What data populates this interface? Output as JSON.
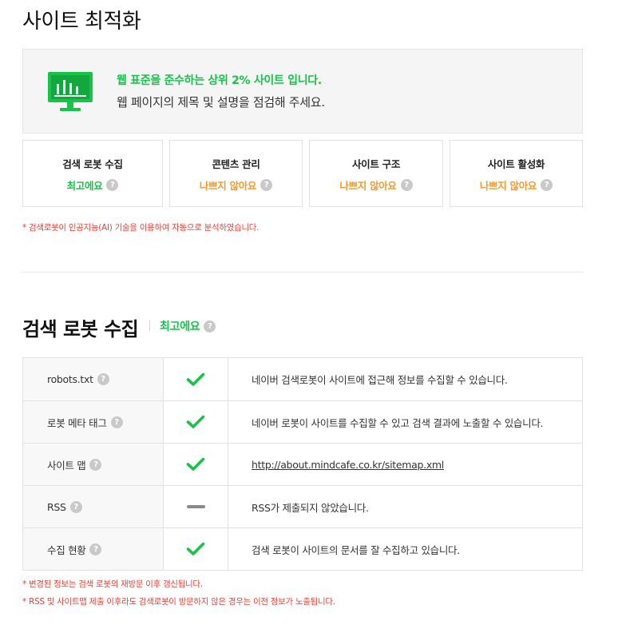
{
  "page_title": "사이트 최적화",
  "summary": {
    "headline": "웹 표준을 준수하는 상위 2% 사이트 입니다.",
    "description": "웹 페이지의 제목 및 설명을 점검해 주세요.",
    "icon": "monitor-chart-icon",
    "accent_color": "#19c24a"
  },
  "cards": [
    {
      "title": "검색 로봇 수집",
      "status": "최고에요",
      "status_color": "#19c24a"
    },
    {
      "title": "콘텐츠 관리",
      "status": "나쁘지 않아요",
      "status_color": "#f39a2c"
    },
    {
      "title": "사이트 구조",
      "status": "나쁘지 않아요",
      "status_color": "#f39a2c"
    },
    {
      "title": "사이트 활성화",
      "status": "나쁘지 않아요",
      "status_color": "#f39a2c"
    }
  ],
  "help_glyph": "?",
  "ai_note": "* 검색로봇이 인공지능(AI) 기술을 이용하여 자동으로 분석하였습니다.",
  "crawl_section": {
    "title": "검색 로봇 수집",
    "status": "최고에요",
    "rows": [
      {
        "label": "robots.txt",
        "icon": "check-icon",
        "description": "네이버 검색로봇이 사이트에 접근해 정보를 수집할 수 있습니다."
      },
      {
        "label": "로봇 메타 태그",
        "icon": "check-icon",
        "description": "네이버 로봇이 사이트를 수집할 수 있고 검색 결과에 노출할 수 있습니다."
      },
      {
        "label": "사이트 맵",
        "icon": "check-icon",
        "description": "http://about.mindcafe.co.kr/sitemap.xml"
      },
      {
        "label": "RSS",
        "icon": "dash-icon",
        "description": "RSS가 제출되지 않았습니다."
      },
      {
        "label": "수집 현황",
        "icon": "check-icon",
        "description": "검색 로봇이 사이트의 문서를 잘 수집하고 있습니다."
      }
    ],
    "notes": [
      "* 변경된 정보는 검색 로봇의 재방문 이후 갱신됩니다.",
      "* RSS 및 사이트맵 제출 이후라도 검색로봇이 방문하지 않은 경우는 이전 정보가 노출됩니다."
    ]
  }
}
